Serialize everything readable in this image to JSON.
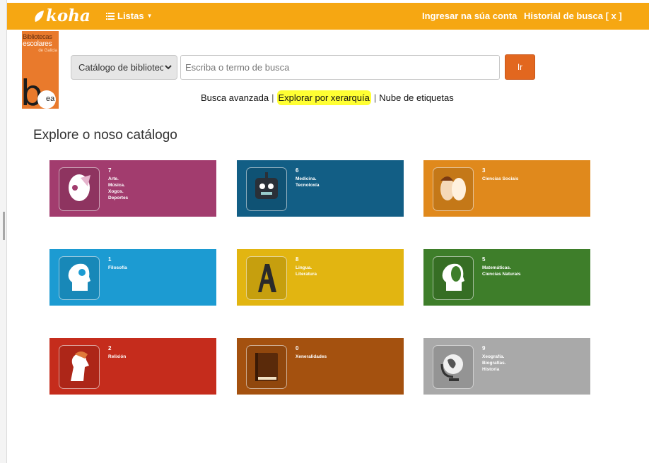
{
  "nav": {
    "brand": "koha",
    "lists_label": "Listas",
    "login_label": "Ingresar na súa conta",
    "history_label": "Historial de busca [ x ]"
  },
  "logo": {
    "line1": "Bibliotecas",
    "line2": "escolares",
    "line3": "de Galicia",
    "mark": "b",
    "mark_suffix": "ea"
  },
  "search": {
    "select_value": "Catálogo de bibliotec",
    "placeholder": "Escriba o termo de busca",
    "go_label": "Ir"
  },
  "links": {
    "advanced": "Busca avanzada",
    "hierarchy": "Explorar por xerarquía",
    "tags": "Nube de etiquetas",
    "separator": "|"
  },
  "page_title": "Explore o noso catálogo",
  "tiles": [
    {
      "code": "7",
      "label": "Arte.\nMúsica.\nXogos.\nDeportes",
      "color": "#a23c6e",
      "icon": "art-face-icon"
    },
    {
      "code": "6",
      "label": "Medicina.\nTecnoloxía",
      "color": "#125e85",
      "icon": "robot-icon"
    },
    {
      "code": "3",
      "label": "Ciencias Sociais",
      "color": "#e0891c",
      "icon": "couple-icon"
    },
    {
      "code": "1",
      "label": "Filosofía",
      "color": "#1c9bd2",
      "icon": "head-profile-icon"
    },
    {
      "code": "8",
      "label": "Lingua.\nLiteratura",
      "color": "#e2b511",
      "icon": "letter-a-icon"
    },
    {
      "code": "5",
      "label": "Matemáticas.\nCiencias Naturais",
      "color": "#3e7e2a",
      "icon": "leaf-head-icon"
    },
    {
      "code": "2",
      "label": "Relixión",
      "color": "#c52c1c",
      "icon": "bearded-figure-icon"
    },
    {
      "code": "0",
      "label": "Xeneralidades",
      "color": "#a4510f",
      "icon": "book-icon"
    },
    {
      "code": "9",
      "label": "Xeografía.\nBiografías.\nHistoria",
      "color": "#a9a9a9",
      "icon": "globe-icon"
    }
  ]
}
